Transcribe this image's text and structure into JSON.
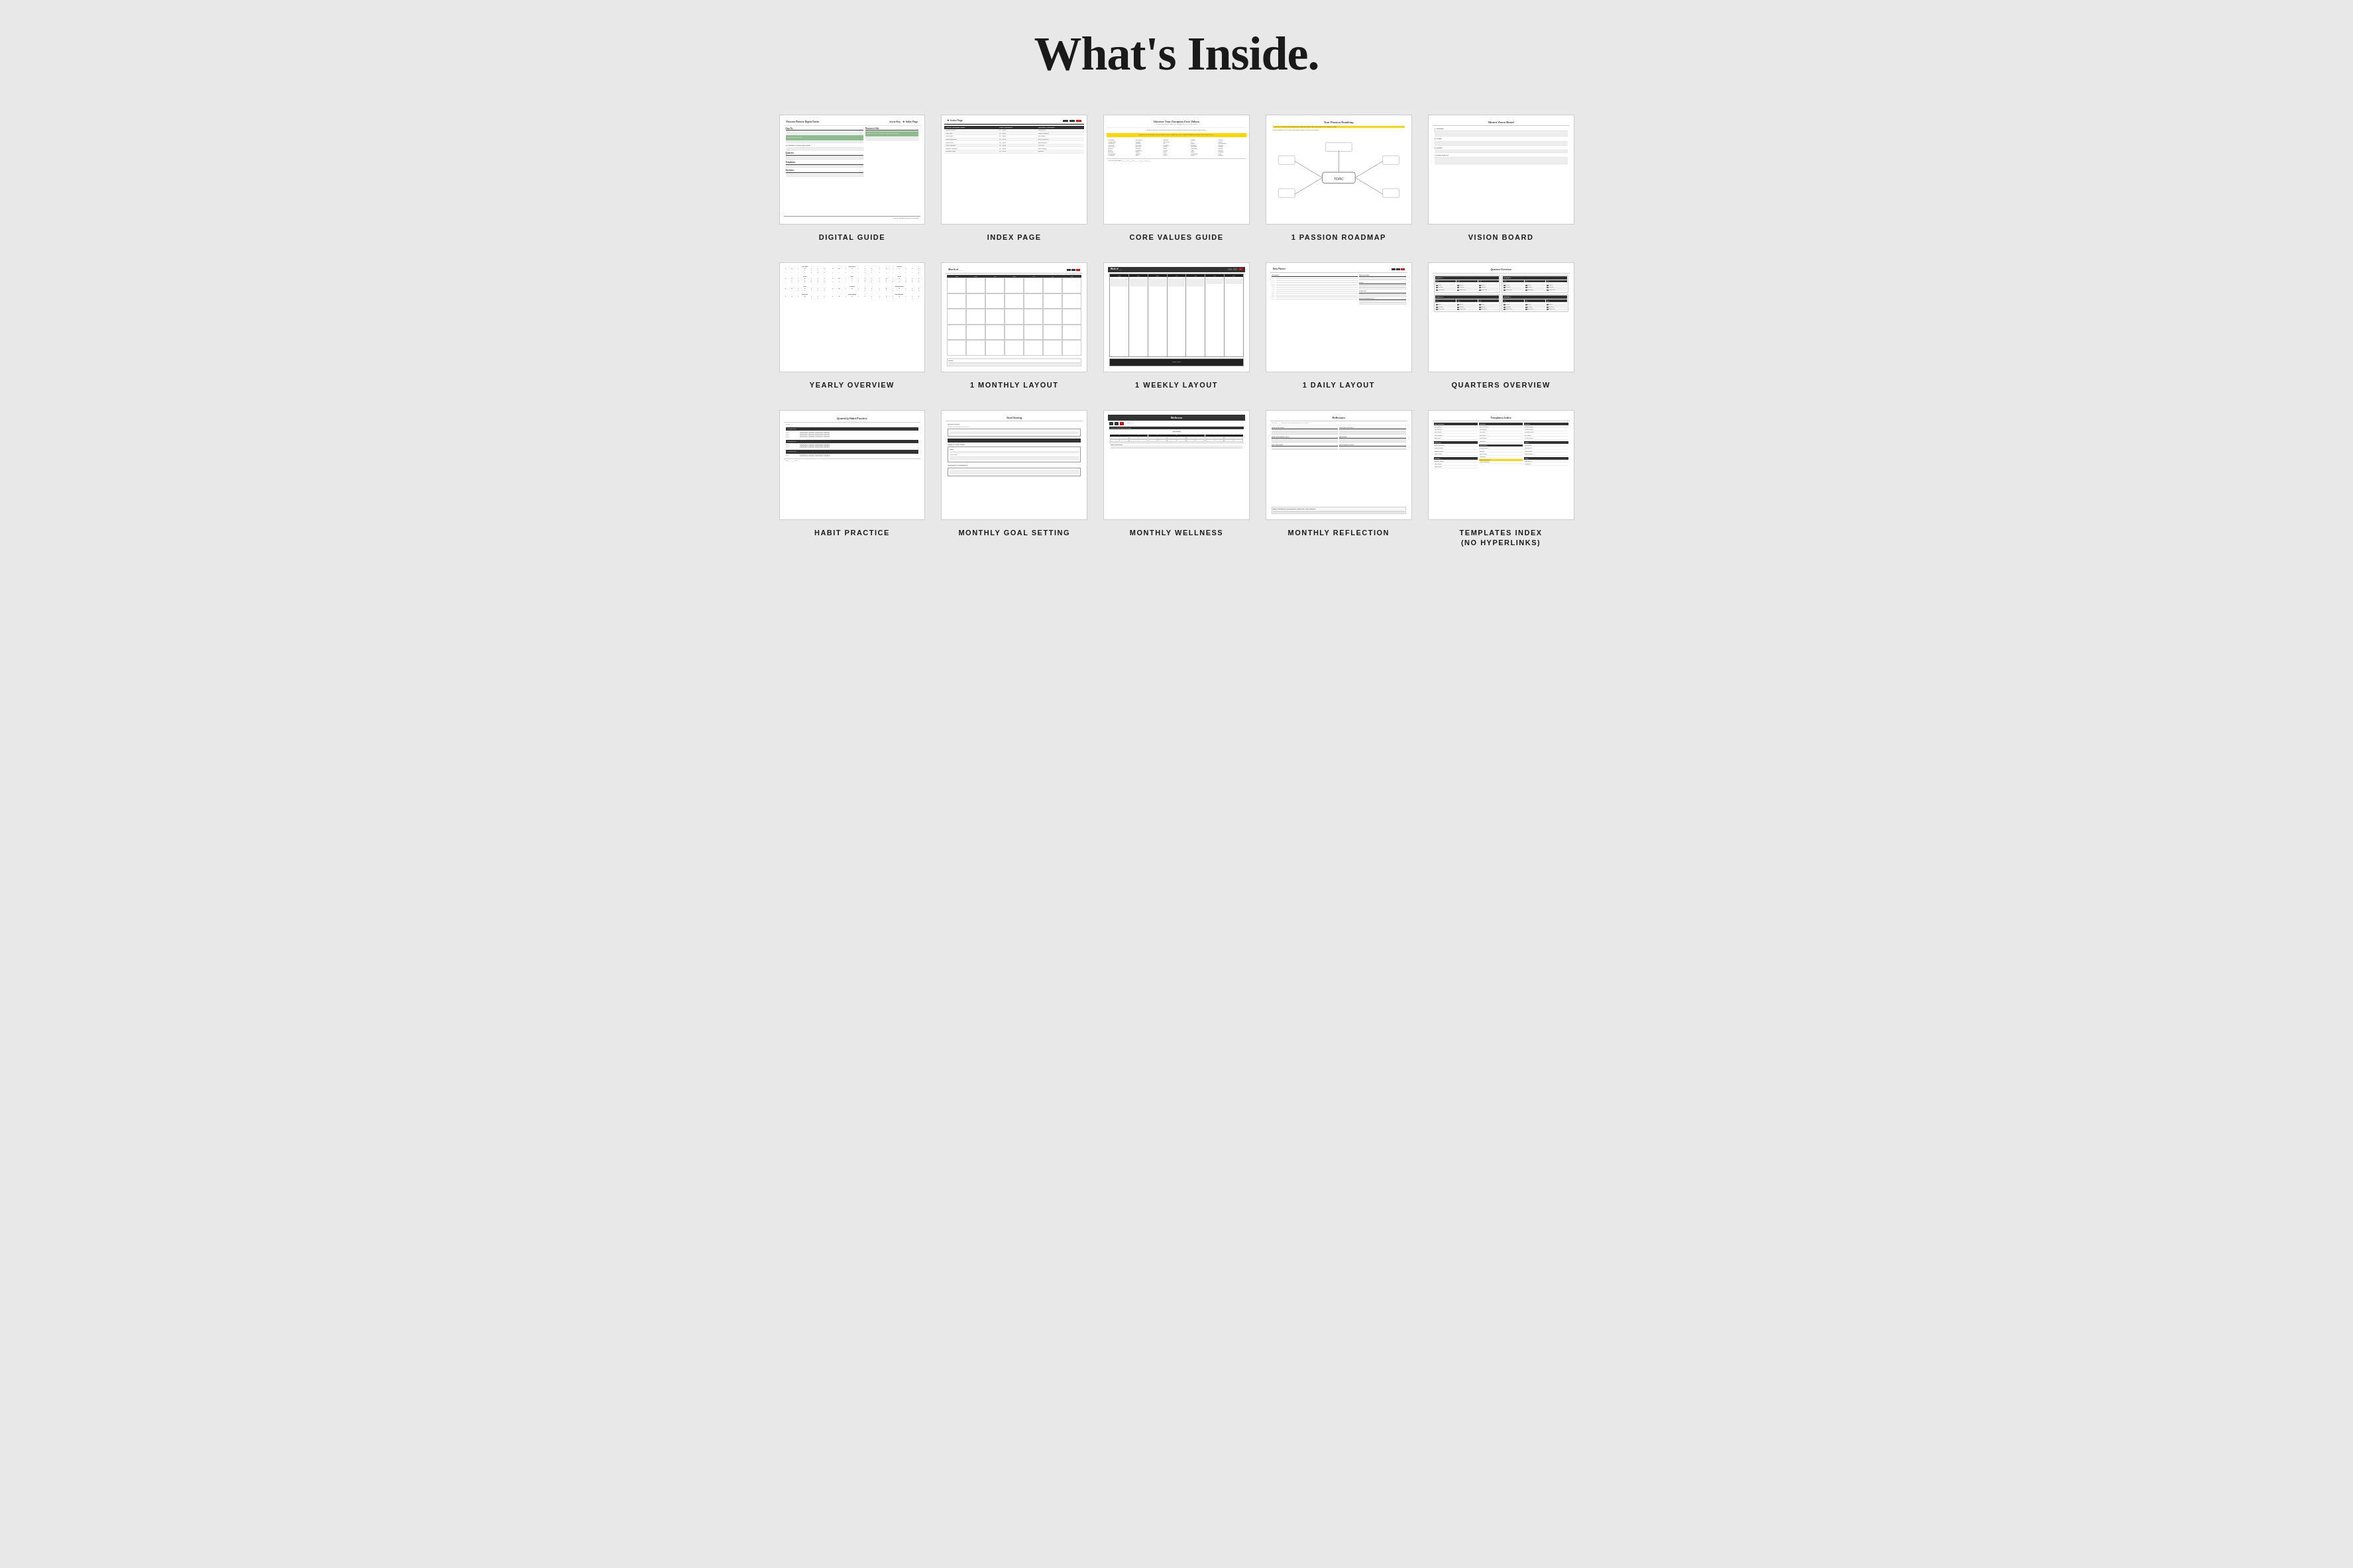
{
  "page": {
    "title": "What's Inside.",
    "background": "#e8e8e8"
  },
  "items": [
    {
      "id": "digital-guide",
      "label": "DIGITAL GUIDE",
      "type": "guide"
    },
    {
      "id": "index-page",
      "label": "INDEX PAGE",
      "type": "index"
    },
    {
      "id": "core-values",
      "label": "CORE VALUES GUIDE",
      "type": "core-values"
    },
    {
      "id": "passion-roadmap",
      "label": "1 PASSION ROADMAP",
      "type": "roadmap"
    },
    {
      "id": "vision-board",
      "label": "VISION BOARD",
      "type": "vision-board"
    },
    {
      "id": "yearly-overview",
      "label": "YEARLY OVERVIEW",
      "type": "yearly"
    },
    {
      "id": "monthly-layout",
      "label": "1 MONTHLY LAYOUT",
      "type": "monthly"
    },
    {
      "id": "weekly-layout",
      "label": "1 WEEKLY LAYOUT",
      "type": "weekly"
    },
    {
      "id": "daily-layout",
      "label": "1 DAILY LAYOUT",
      "type": "daily"
    },
    {
      "id": "quarters-overview",
      "label": "QUARTERS OVERVIEW",
      "type": "quarters"
    },
    {
      "id": "habit-practice",
      "label": "HABIT PRACTICE",
      "type": "habit"
    },
    {
      "id": "monthly-goal",
      "label": "MONTHLY GOAL SETTING",
      "type": "goal"
    },
    {
      "id": "monthly-wellness",
      "label": "MONTHLY WELLNESS",
      "type": "wellness"
    },
    {
      "id": "monthly-reflection",
      "label": "MONTHLY REFLECTION",
      "type": "reflection"
    },
    {
      "id": "templates-index",
      "label": "TEMPLATES INDEX\n(NO HYPERLINKS)",
      "type": "templates"
    }
  ],
  "months": [
    "January",
    "February",
    "March",
    "April",
    "May",
    "June",
    "July",
    "August",
    "September",
    "October",
    "November",
    "December"
  ],
  "days": [
    "S",
    "M",
    "T",
    "W",
    "T",
    "F",
    "S"
  ]
}
